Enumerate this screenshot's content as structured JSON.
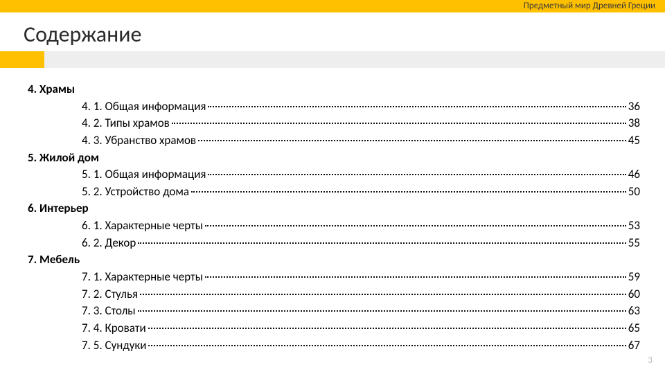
{
  "header": {
    "stripe_label": "Предметный мир Древней Греции",
    "title": "Содержание"
  },
  "toc": [
    {
      "heading": "4. Храмы",
      "items": [
        {
          "label": "4. 1. Общая информация",
          "page": "36"
        },
        {
          "label": "4. 2. Типы храмов",
          "page": "38"
        },
        {
          "label": "4. 3. Убранство храмов",
          "page": "45"
        }
      ]
    },
    {
      "heading": "5. Жилой дом",
      "items": [
        {
          "label": "5. 1. Общая информация",
          "page": "46"
        },
        {
          "label": "5. 2. Устройство дома",
          "page": "50"
        }
      ]
    },
    {
      "heading": "6. Интерьер",
      "items": [
        {
          "label": "6. 1. Характерные черты",
          "page": "53"
        },
        {
          "label": "6. 2. Декор",
          "page": "55"
        }
      ]
    },
    {
      "heading": "7. Мебель",
      "items": [
        {
          "label": "7. 1. Характерные черты",
          "page": "59"
        },
        {
          "label": "7. 2. Стулья",
          "page": "60"
        },
        {
          "label": "7. 3. Столы",
          "page": "63"
        },
        {
          "label": "7. 4. Кровати",
          "page": "65"
        },
        {
          "label": "7. 5. Сундуки",
          "page": "67"
        }
      ]
    }
  ],
  "footer": {
    "page_number": "3"
  }
}
